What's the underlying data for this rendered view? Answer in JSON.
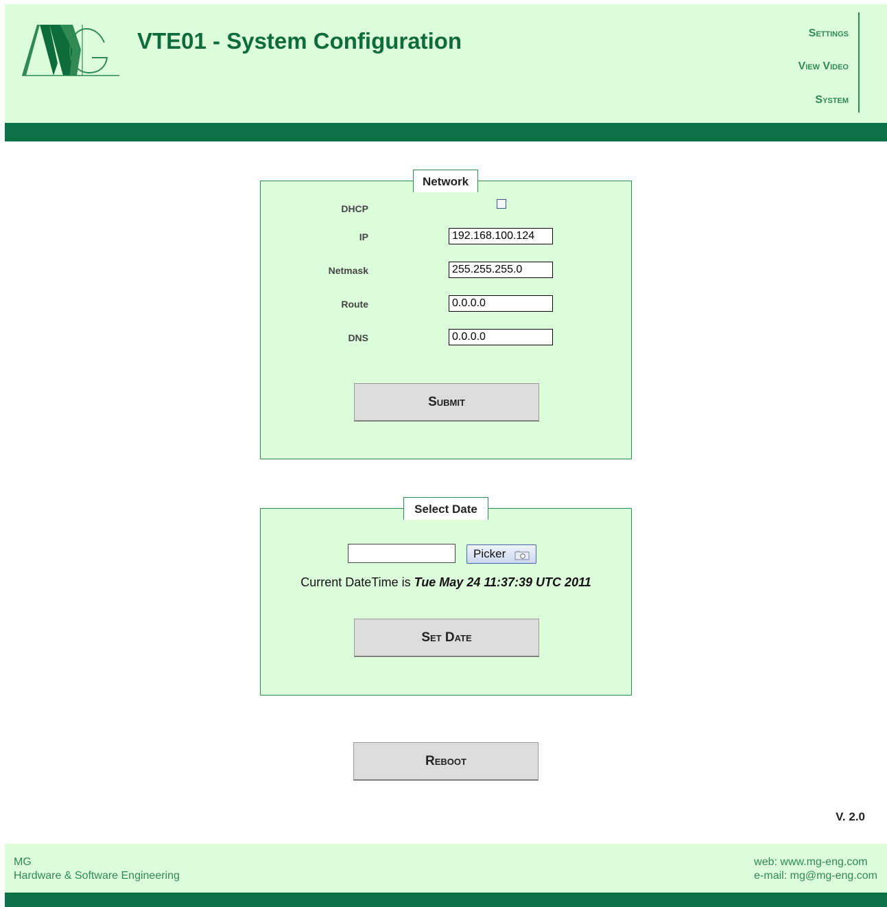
{
  "header": {
    "title": "VTE01 - System Configuration",
    "nav": [
      "Settings",
      "View Video",
      "System"
    ]
  },
  "network": {
    "legend": "Network",
    "dhcp_label": "DHCP",
    "dhcp_checked": false,
    "ip_label": "IP",
    "ip_value": "192.168.100.124",
    "netmask_label": "Netmask",
    "netmask_value": "255.255.255.0",
    "route_label": "Route",
    "route_value": "0.0.0.0",
    "dns_label": "DNS",
    "dns_value": "0.0.0.0",
    "submit_label": "Submit"
  },
  "date": {
    "legend": "Select Date",
    "input_value": "",
    "picker_label": "Picker",
    "current_prefix": "Current DateTime is",
    "current_value": "Tue May 24 11:37:39 UTC 2011",
    "set_label": "Set Date"
  },
  "reboot_label": "Reboot",
  "version": "V. 2.0",
  "footer": {
    "company": "MG",
    "tagline": "Hardware & Software Engineering",
    "web": "web: www.mg-eng.com",
    "email": "e-mail: mg@mg-eng.com"
  },
  "colors": {
    "header_bg": "#ddfedb",
    "accent_dark": "#0b7247",
    "title_green": "#0e6b3a",
    "nav_green": "#2f8a52"
  }
}
